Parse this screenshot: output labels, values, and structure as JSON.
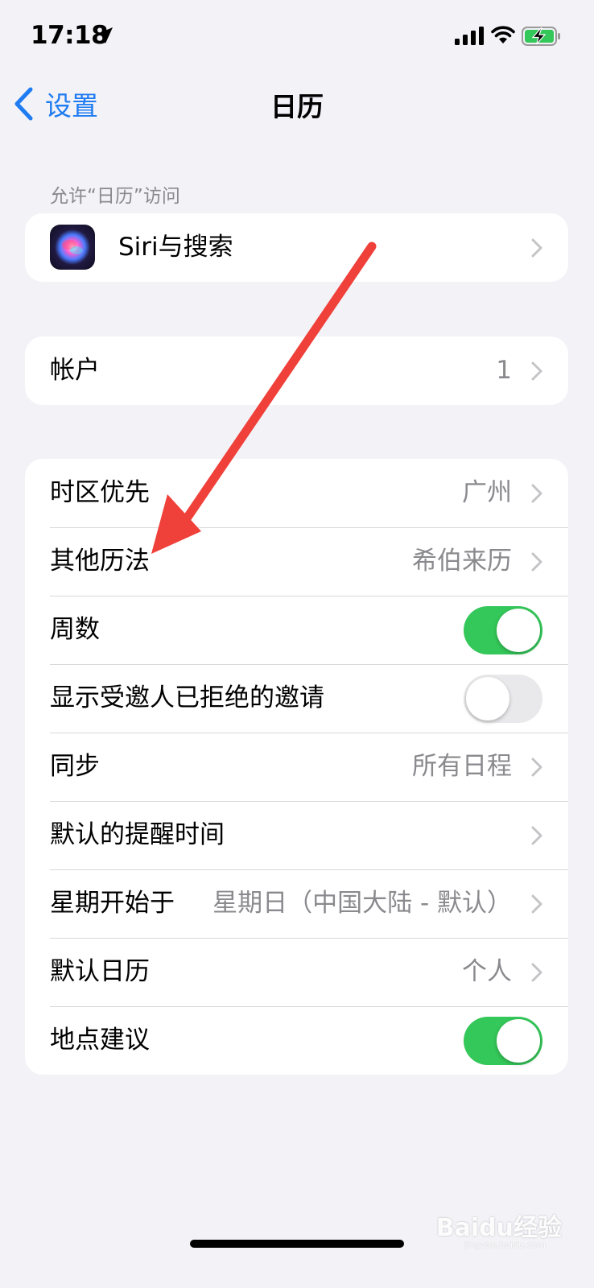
{
  "status_bar": {
    "time": "17:18",
    "icons": [
      "location-arrow-icon",
      "cellular-signal-icon",
      "wifi-icon",
      "battery-charging-icon"
    ],
    "battery_color": "#34c759"
  },
  "nav": {
    "back_label": "设置",
    "title": "日历",
    "accent": "#1f7cf2"
  },
  "sections": {
    "access_header": "允许“日历”访问",
    "siri": {
      "label": "Siri与搜索"
    },
    "accounts": {
      "label": "帐户",
      "value": "1"
    },
    "settings": [
      {
        "label": "时区优先",
        "value": "广州",
        "type": "chevron"
      },
      {
        "label": "其他历法",
        "value": "希伯来历",
        "type": "chevron"
      },
      {
        "label": "周数",
        "type": "toggle",
        "on": true
      },
      {
        "label": "显示受邀人已拒绝的邀请",
        "type": "toggle",
        "on": false
      },
      {
        "label": "同步",
        "value": "所有日程",
        "type": "chevron"
      },
      {
        "label": "默认的提醒时间",
        "value": "",
        "type": "chevron"
      },
      {
        "label": "星期开始于",
        "value": "星期日（中国大陆 - 默认）",
        "type": "chevron"
      },
      {
        "label": "默认日历",
        "value": "个人",
        "type": "chevron"
      },
      {
        "label": "地点建议",
        "type": "toggle",
        "on": true
      }
    ]
  },
  "annotation": {
    "color": "#f0403a"
  },
  "watermark": {
    "text": "Baidu经验",
    "sub": "jingyan.baidu.com"
  }
}
